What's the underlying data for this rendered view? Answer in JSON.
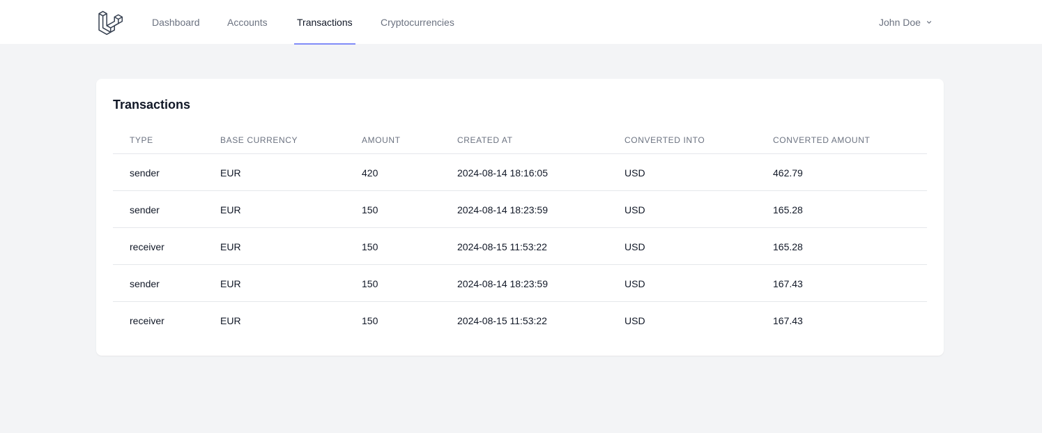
{
  "nav": {
    "links": [
      "Dashboard",
      "Accounts",
      "Transactions",
      "Cryptocurrencies"
    ],
    "active": "Transactions",
    "user_name": "John Doe",
    "accent_color": "#818cf8"
  },
  "card": {
    "title": "Transactions"
  },
  "table": {
    "headers": [
      "TYPE",
      "BASE CURRENCY",
      "AMOUNT",
      "CREATED AT",
      "CONVERTED INTO",
      "CONVERTED AMOUNT"
    ],
    "rows": [
      [
        "sender",
        "EUR",
        "420",
        "2024-08-14 18:16:05",
        "USD",
        "462.79"
      ],
      [
        "sender",
        "EUR",
        "150",
        "2024-08-14 18:23:59",
        "USD",
        "165.28"
      ],
      [
        "receiver",
        "EUR",
        "150",
        "2024-08-15 11:53:22",
        "USD",
        "165.28"
      ],
      [
        "sender",
        "EUR",
        "150",
        "2024-08-14 18:23:59",
        "USD",
        "167.43"
      ],
      [
        "receiver",
        "EUR",
        "150",
        "2024-08-15 11:53:22",
        "USD",
        "167.43"
      ]
    ]
  },
  "icons": {
    "logo": "laravel-logo-icon",
    "user_menu": "chevron-down-icon"
  }
}
